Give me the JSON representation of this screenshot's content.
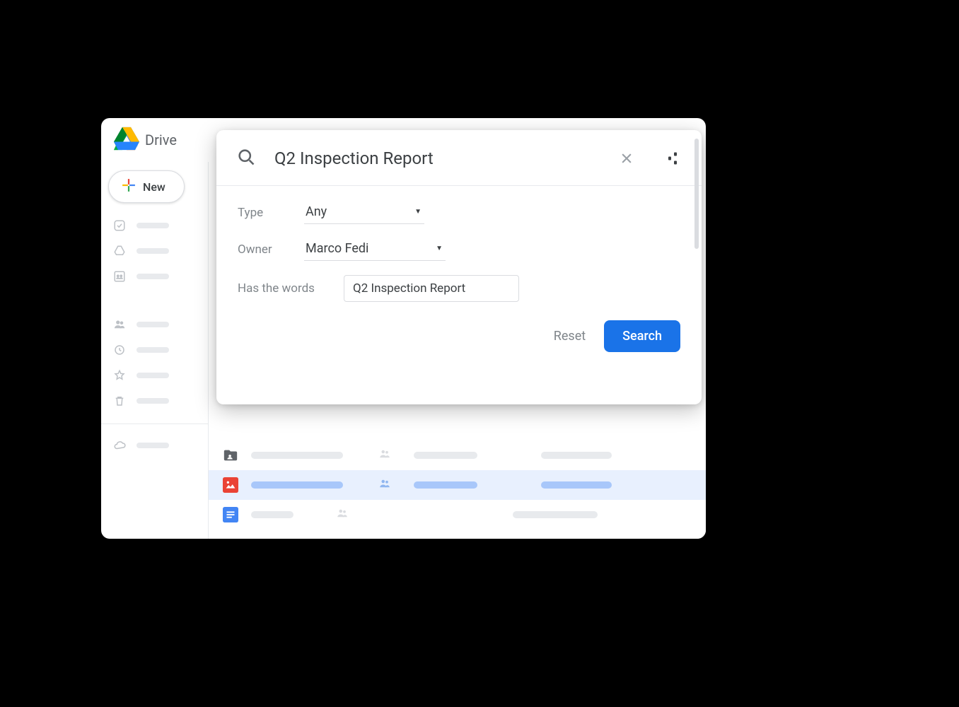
{
  "app": {
    "name": "Drive"
  },
  "sidebar": {
    "new_label": "New"
  },
  "search": {
    "query": "Q2 Inspection Report",
    "filters": {
      "type_label": "Type",
      "type_value": "Any",
      "owner_label": "Owner",
      "owner_value": "Marco Fedi",
      "words_label": "Has the words",
      "words_value": "Q2 Inspection Report"
    },
    "actions": {
      "reset": "Reset",
      "search": "Search"
    }
  }
}
